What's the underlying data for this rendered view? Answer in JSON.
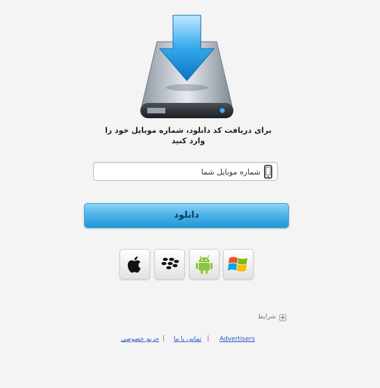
{
  "prompt": {
    "text": "برای دریافت کد دانلود، شماره موبایل خود را وارد کنید"
  },
  "phone_input": {
    "placeholder": "شماره موبایل شما",
    "value": ""
  },
  "download_button": {
    "label": "دانلود"
  },
  "platforms": [
    {
      "name": "apple",
      "icon": "apple-icon"
    },
    {
      "name": "blackberry",
      "icon": "blackberry-icon"
    },
    {
      "name": "android",
      "icon": "android-icon"
    },
    {
      "name": "windows",
      "icon": "windows-icon"
    }
  ],
  "terms": {
    "label": "شرایط",
    "toggle": "+"
  },
  "footer": {
    "advertisers": "Advertisers",
    "contact": "تماس با ما",
    "privacy": "حریم خصوصی",
    "separator": "|"
  },
  "colors": {
    "accent": "#2aa3e3",
    "link": "#2b57c9",
    "background": "#f4f4f4"
  }
}
